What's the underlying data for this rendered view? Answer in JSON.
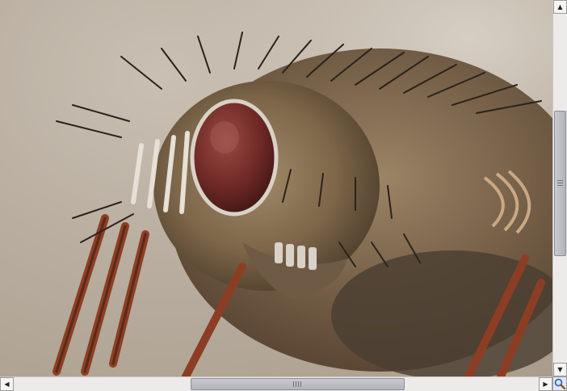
{
  "viewer": {
    "image_subject": "fly-macro-photo",
    "zoom_icon": "magnifier-icon"
  },
  "scroll": {
    "vertical_position": 0.49,
    "horizontal_position": 0.42
  },
  "colors": {
    "scrollbar_track": "#ecebea",
    "scrollbar_thumb": "#b3b3bc",
    "eye": "#7a2e2a",
    "body": "#8a7458"
  }
}
